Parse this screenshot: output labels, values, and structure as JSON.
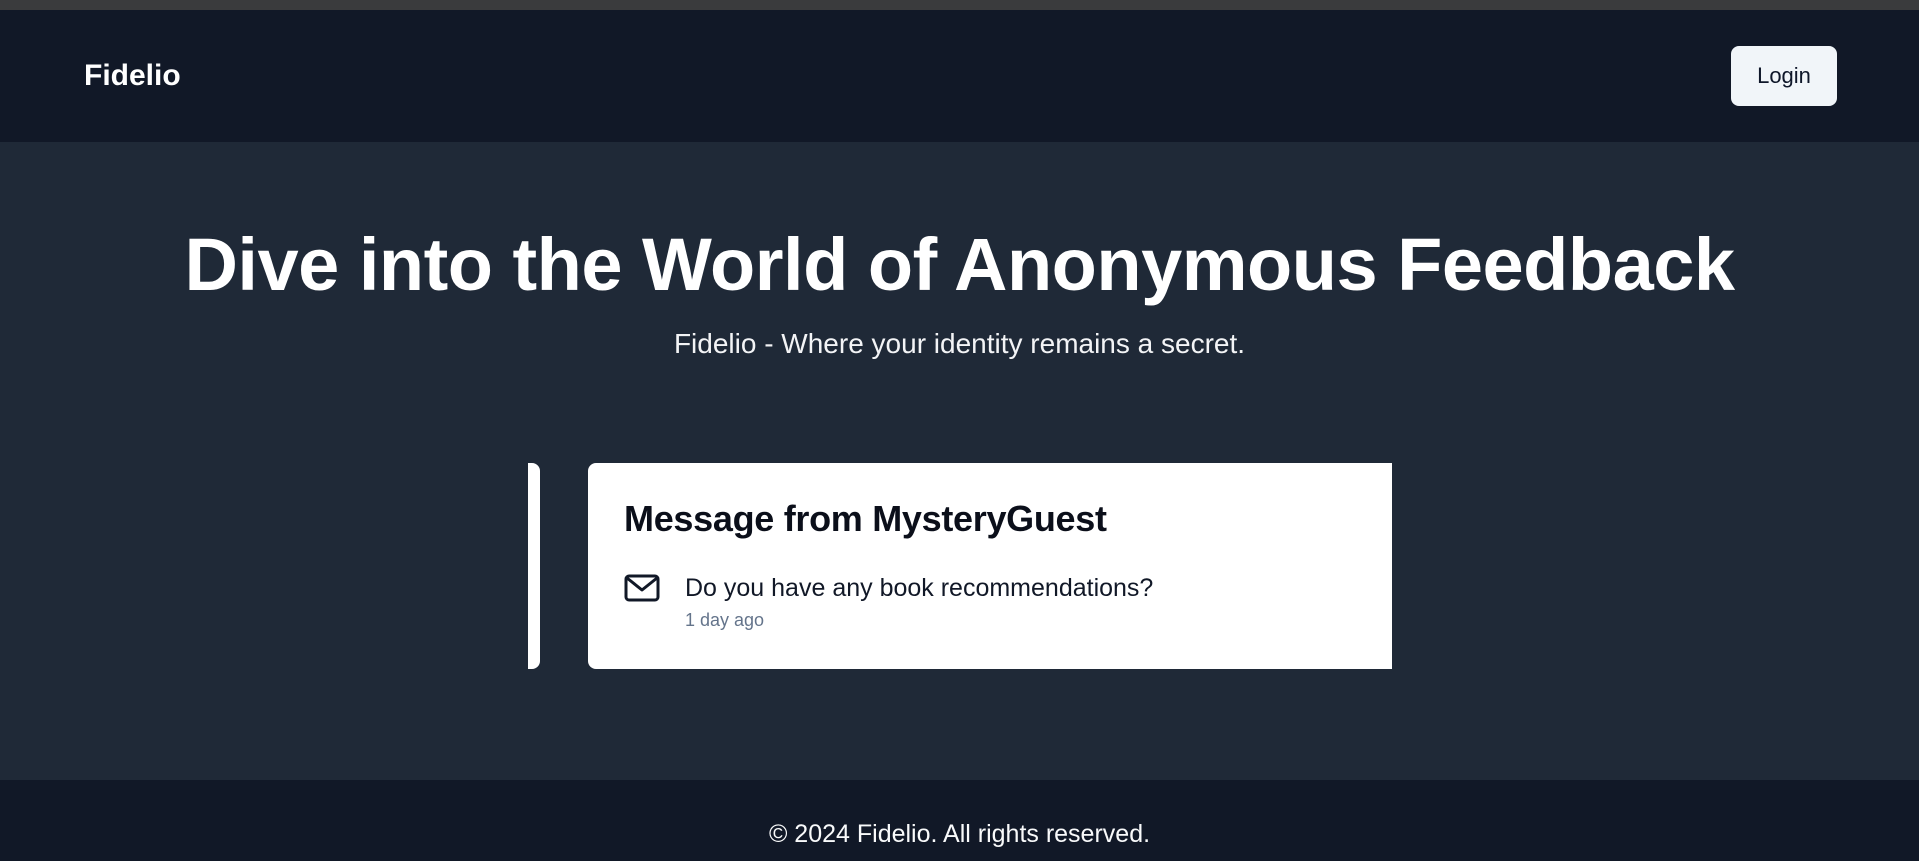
{
  "navbar": {
    "brand": "Fidelio",
    "login_label": "Login"
  },
  "hero": {
    "title": "Dive into the World of Anonymous Feedback",
    "subtitle": "Fidelio - Where your identity remains a secret."
  },
  "carousel": {
    "current_card": {
      "title": "Message from MysteryGuest",
      "icon": "mail-icon",
      "message": "Do you have any book recommendations?",
      "time": "1 day ago"
    }
  },
  "footer": {
    "text": "© 2024 Fidelio. All rights reserved."
  },
  "colors": {
    "navbar_bg": "#111827",
    "page_bg": "#1f2937",
    "card_bg": "#ffffff",
    "button_bg": "#f1f5f9",
    "muted_text": "#64748b"
  }
}
